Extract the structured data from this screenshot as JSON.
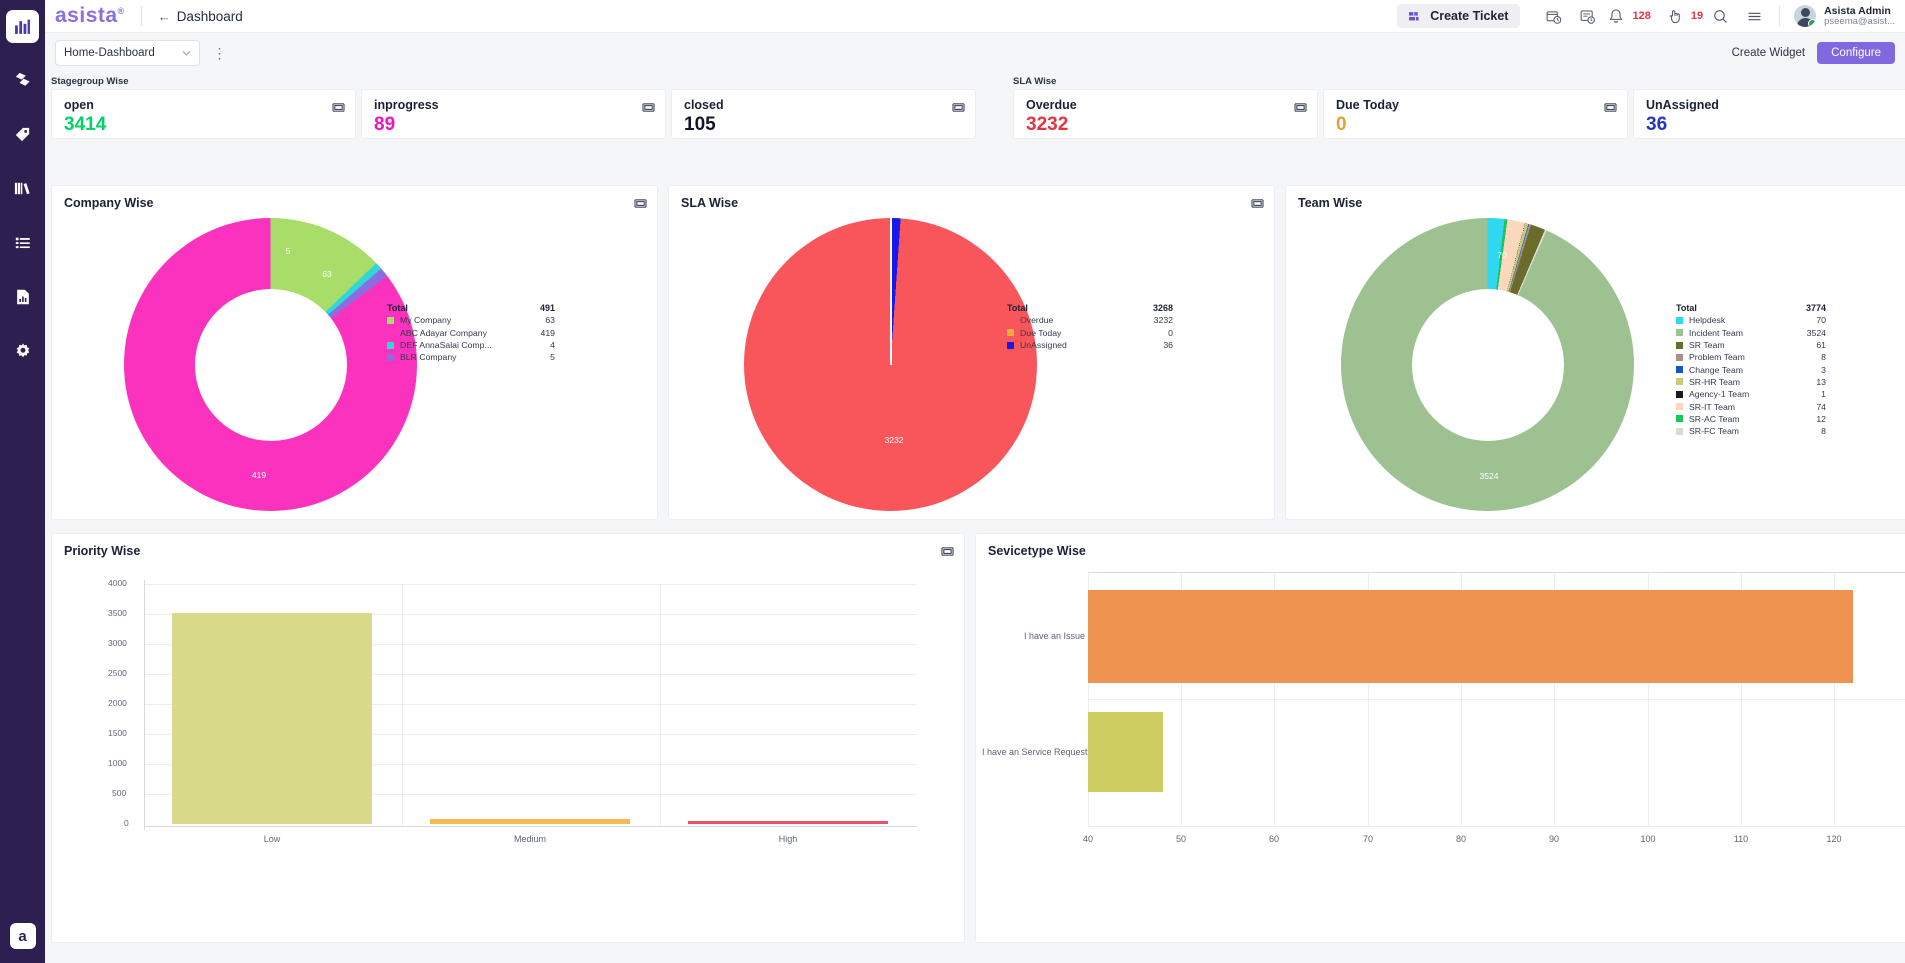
{
  "app": {
    "brand": "asista",
    "brand_mark": "®"
  },
  "topbar": {
    "back_arrow": "←",
    "breadcrumb": "Dashboard",
    "create_ticket": "Create Ticket",
    "icons": [
      "ticket-clock-icon",
      "document-clock-icon",
      "bell-icon",
      "hand-click-icon",
      "search-icon",
      "menu-icon"
    ],
    "notification_count": "128",
    "task_count": "19",
    "user_name": "Asista Admin",
    "user_email": "pseema@asist..."
  },
  "subbar": {
    "dashboard_select": "Home-Dashboard",
    "chevron": "⌄",
    "kebab": "⋮",
    "create_widget": "Create Widget",
    "configure": "Configure"
  },
  "sidebar": {
    "items": [
      {
        "name": "dashboard",
        "icon": "bar-chart-icon",
        "active": true
      },
      {
        "name": "assets",
        "icon": "diamond-icon",
        "active": false
      },
      {
        "name": "tags",
        "icon": "tag-icon",
        "active": false
      },
      {
        "name": "knowledge",
        "icon": "books-icon",
        "active": false
      },
      {
        "name": "lists",
        "icon": "list-icon",
        "active": false
      },
      {
        "name": "reports",
        "icon": "report-icon",
        "active": false
      },
      {
        "name": "settings",
        "icon": "gear-icon",
        "active": false
      }
    ],
    "logo_letter": "a"
  },
  "groups": {
    "stagegroup": "Stagegroup Wise",
    "sla": "SLA Wise"
  },
  "stat_cards": [
    {
      "title": "open",
      "value": "3414",
      "color": "#00d26a"
    },
    {
      "title": "inprogress",
      "value": "89",
      "color": "#f213c0"
    },
    {
      "title": "closed",
      "value": "105",
      "color": "#101828"
    },
    {
      "title": "Overdue",
      "value": "3232",
      "color": "#e4353f"
    },
    {
      "title": "Due Today",
      "value": "0",
      "color": "#e0a32e"
    },
    {
      "title": "UnAssigned",
      "value": "36",
      "color": "#2436c9"
    }
  ],
  "panels": {
    "company": "Company Wise",
    "sla": "SLA Wise",
    "team": "Team Wise",
    "priority": "Priority Wise",
    "servicetype": "Sevicetype Wise"
  },
  "legend_headers": {
    "total": "Total"
  },
  "chart_data": [
    {
      "type": "pie",
      "title": "Company Wise",
      "total_label": "Total",
      "total": 491,
      "labels": [
        "My Company",
        "ABC Adayar Company",
        "DEF AnnaSalai Comp...",
        "BLR Company"
      ],
      "values": [
        63,
        419,
        4,
        5
      ],
      "colors": [
        "#a8dd6a",
        "#fb32bd",
        "#2fd7d7",
        "#8a6ee0"
      ],
      "data_labels": [
        "63",
        "419",
        "5"
      ],
      "donut": true,
      "legend_position": "right"
    },
    {
      "type": "pie",
      "title": "SLA Wise",
      "total_label": "Total",
      "total": 3268,
      "labels": [
        "Overdue",
        "Due Today",
        "UnAssigned"
      ],
      "values": [
        3232,
        0,
        36
      ],
      "colors": [
        "#f9565c",
        "#f5a93e",
        "#1818e8"
      ],
      "data_labels": [
        "3232"
      ],
      "donut": false,
      "legend_position": "right"
    },
    {
      "type": "pie",
      "title": "Team Wise",
      "total_label": "Total",
      "total": 3774,
      "labels": [
        "Helpdesk",
        "Incident Team",
        "SR Team",
        "Problem Team",
        "Change Team",
        "SR-HR Team",
        "Agency-1 Team",
        "SR-IT Team",
        "SR-AC Team",
        "SR-FC Team"
      ],
      "values": [
        70,
        3524,
        61,
        8,
        3,
        13,
        1,
        74,
        12,
        8
      ],
      "colors": [
        "#2fd7f0",
        "#9dc191",
        "#6b6b2a",
        "#ad8f8c",
        "#1155cc",
        "#c5cf7a",
        "#1a1a1a",
        "#fbd8bb",
        "#17c65c",
        "#d7dbd2"
      ],
      "data_labels": [
        "3524",
        "70"
      ],
      "donut": true,
      "legend_position": "right"
    },
    {
      "type": "bar",
      "title": "Priority Wise",
      "categories": [
        "Low",
        "Medium",
        "High"
      ],
      "values": [
        3490,
        82,
        16
      ],
      "colors": [
        "#d8da8a",
        "#f3bb52",
        "#e9516a"
      ],
      "ylim": [
        0,
        4000
      ],
      "yticks": [
        "0",
        "500",
        "1000",
        "1500",
        "2000",
        "2500",
        "3000",
        "3500",
        "4000"
      ],
      "xlabel": "",
      "ylabel": "",
      "grid": true,
      "orientation": "vertical"
    },
    {
      "type": "bar",
      "title": "Sevicetype Wise",
      "categories": [
        "I have an Issue",
        "I have an Service Request"
      ],
      "values": [
        122,
        48
      ],
      "colors": [
        "#ef9350",
        "#cdcc61"
      ],
      "xlim": [
        40,
        130
      ],
      "xticks": [
        "40",
        "50",
        "60",
        "70",
        "80",
        "90",
        "100",
        "110",
        "120",
        "130"
      ],
      "grid": true,
      "orientation": "horizontal"
    }
  ]
}
